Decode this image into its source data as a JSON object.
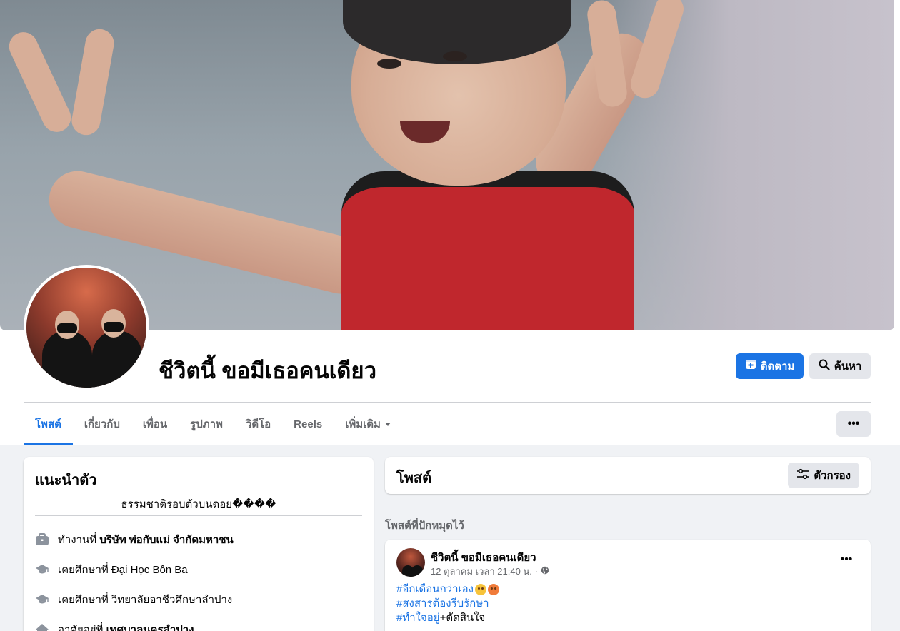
{
  "profile": {
    "name": "ชีวิตนี้ ขอมีเธอคนเดียว",
    "follow_label": "ติดตาม",
    "search_label": "ค้นหา",
    "more_label": "•••"
  },
  "tabs": [
    {
      "label": "โพสต์"
    },
    {
      "label": "เกี่ยวกับ"
    },
    {
      "label": "เพื่อน"
    },
    {
      "label": "รูปภาพ"
    },
    {
      "label": "วิดีโอ"
    },
    {
      "label": "Reels"
    },
    {
      "label": "เพิ่มเติม"
    }
  ],
  "intro": {
    "title": "แนะนำตัว",
    "bio": "ธรรมชาติรอบตัวบนดอย����",
    "rows": [
      {
        "prefix": "ทำงานที่ ",
        "value": "บริษัท พ่อกับแม่ จำกัดมหาชน",
        "icon": "briefcase-icon"
      },
      {
        "prefix": "เคยศึกษาที่ ",
        "value": "Đại Học Bôn Ba",
        "icon": "graduation-cap-icon"
      },
      {
        "prefix": "เคยศึกษาที่ วิทยาลัยอาชีวศึกษาลำปาง",
        "value": "",
        "icon": "graduation-cap-icon"
      },
      {
        "prefix": "อาศัยอยู่ที่ ",
        "value": "เทศบาลนครลำปาง",
        "icon": "home-icon"
      }
    ]
  },
  "posts_header": {
    "title": "โพสต์",
    "filter_label": "ตัวกรอง"
  },
  "pinned_label": "โพสต์ที่ปักหมุดไว้",
  "post": {
    "author": "ชีวิตนี้ ขอมีเธอคนเดียว",
    "timestamp": "12 ตุลาคม เวลา 21:40 น.",
    "separator": "·",
    "more_label": "•••",
    "line1_tag": "#อีกเดือนกว่าเอง",
    "line2_tag": "#สงสารต้องรีบรักษา",
    "line3_tag": "#ทำใจอยู่",
    "line3_text": "+ตัดสินใจ"
  },
  "colors": {
    "accent": "#1b74e4",
    "page_bg": "#f0f2f5",
    "secondary_text": "#65676b",
    "button_gray": "#e4e6eb"
  }
}
